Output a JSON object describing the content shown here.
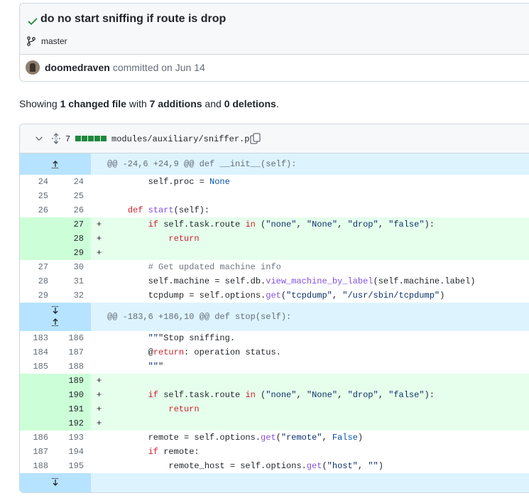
{
  "commit": {
    "title": "do no start sniffing if route is drop",
    "branch": "master",
    "author": "doomedraven",
    "committed_text": "committed on Jun 14"
  },
  "summary": {
    "prefix": "Showing ",
    "changed": "1 changed file",
    "mid": " with ",
    "additions": "7 additions",
    "and": " and ",
    "deletions": "0 deletions",
    "suffix": "."
  },
  "file": {
    "additions_count": "7",
    "path": "modules/auxiliary/sniffer.py",
    "diffstat_blocks": 5
  },
  "hunks": [
    {
      "header": "@@ -24,6 +24,9 @@ def __init__(self):"
    },
    {
      "header": "@@ -183,6 +186,10 @@ def stop(self):"
    }
  ],
  "lines_a": [
    {
      "old": "24",
      "new": "24",
      "sign": "",
      "type": "ctx",
      "code": "        self.proc = None"
    },
    {
      "old": "25",
      "new": "25",
      "sign": "",
      "type": "ctx",
      "code": ""
    },
    {
      "old": "26",
      "new": "26",
      "sign": "",
      "type": "ctx",
      "code": "    def start(self):"
    },
    {
      "old": "",
      "new": "27",
      "sign": "+",
      "type": "add",
      "code": "        if self.task.route in (\"none\", \"None\", \"drop\", \"false\"):"
    },
    {
      "old": "",
      "new": "28",
      "sign": "+",
      "type": "add",
      "code": "            return"
    },
    {
      "old": "",
      "new": "29",
      "sign": "+",
      "type": "add",
      "code": ""
    },
    {
      "old": "27",
      "new": "30",
      "sign": "",
      "type": "ctx",
      "code": "        # Get updated machine info"
    },
    {
      "old": "28",
      "new": "31",
      "sign": "",
      "type": "ctx",
      "code": "        self.machine = self.db.view_machine_by_label(self.machine.label)"
    },
    {
      "old": "29",
      "new": "32",
      "sign": "",
      "type": "ctx",
      "code": "        tcpdump = self.options.get(\"tcpdump\", \"/usr/sbin/tcpdump\")"
    }
  ],
  "lines_b": [
    {
      "old": "183",
      "new": "186",
      "sign": "",
      "type": "ctx",
      "code": "        \"\"\"Stop sniffing."
    },
    {
      "old": "184",
      "new": "187",
      "sign": "",
      "type": "ctx",
      "code": "        @return: operation status."
    },
    {
      "old": "185",
      "new": "188",
      "sign": "",
      "type": "ctx",
      "code": "        \"\"\""
    },
    {
      "old": "",
      "new": "189",
      "sign": "+",
      "type": "add",
      "code": ""
    },
    {
      "old": "",
      "new": "190",
      "sign": "+",
      "type": "add",
      "code": "        if self.task.route in (\"none\", \"None\", \"drop\", \"false\"):"
    },
    {
      "old": "",
      "new": "191",
      "sign": "+",
      "type": "add",
      "code": "            return"
    },
    {
      "old": "",
      "new": "192",
      "sign": "+",
      "type": "add",
      "code": ""
    },
    {
      "old": "186",
      "new": "193",
      "sign": "",
      "type": "ctx",
      "code": "        remote = self.options.get(\"remote\", False)"
    },
    {
      "old": "187",
      "new": "194",
      "sign": "",
      "type": "ctx",
      "code": "        if remote:"
    },
    {
      "old": "188",
      "new": "195",
      "sign": "",
      "type": "ctx",
      "code": "            remote_host = self.options.get(\"host\", \"\")"
    }
  ],
  "colors": {
    "addition_bg": "#e6ffec",
    "addition_gutter": "#ccffd8",
    "hunk_bg": "#ddf4ff",
    "hunk_gutter": "#b6e3ff",
    "success_green": "#1f883d"
  },
  "icons": [
    "check-icon",
    "git-branch-icon",
    "chevron-down-icon",
    "fold-icon",
    "copy-icon",
    "expand-up-icon",
    "expand-down-icon"
  ]
}
